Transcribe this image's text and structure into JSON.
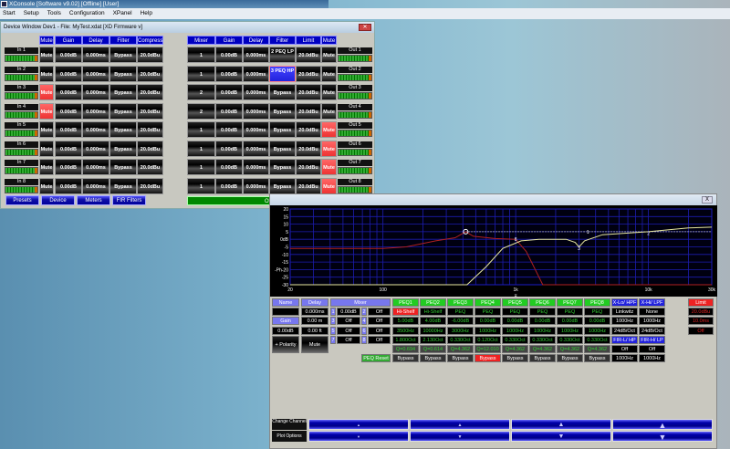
{
  "app": {
    "title": "XConsole [Software v9.02] [Offline] [User]",
    "menu": [
      "Start",
      "Setup",
      "Tools",
      "Configuration",
      "XPanel",
      "Help"
    ]
  },
  "device_window": {
    "title": "Device Window Dev1 -  File: MyTest.xdat [XD Firmware v]",
    "input_headers": [
      "Mute",
      "Gain",
      "Delay",
      "Filter",
      "Compress"
    ],
    "output_headers": [
      "Mixer",
      "Gain",
      "Delay",
      "Filter",
      "Limit",
      "Mute"
    ],
    "inputs": [
      {
        "name": "In 1",
        "mute": "Mute",
        "muted": false,
        "gain": "0.00dB",
        "delay": "0.000ms",
        "filter": "Bypass",
        "compress": "20.0dBu"
      },
      {
        "name": "In 2",
        "mute": "Mute",
        "muted": false,
        "gain": "0.00dB",
        "delay": "0.000ms",
        "filter": "Bypass",
        "compress": "20.0dBu"
      },
      {
        "name": "In 3",
        "mute": "Mute",
        "muted": true,
        "gain": "0.00dB",
        "delay": "0.000ms",
        "filter": "Bypass",
        "compress": "20.0dBu"
      },
      {
        "name": "In 4",
        "mute": "Mute",
        "muted": true,
        "gain": "0.00dB",
        "delay": "0.000ms",
        "filter": "Bypass",
        "compress": "20.0dBu"
      },
      {
        "name": "In 5",
        "mute": "Mute",
        "muted": false,
        "gain": "0.00dB",
        "delay": "0.000ms",
        "filter": "Bypass",
        "compress": "20.0dBu"
      },
      {
        "name": "In 6",
        "mute": "Mute",
        "muted": false,
        "gain": "0.00dB",
        "delay": "0.000ms",
        "filter": "Bypass",
        "compress": "20.0dBu"
      },
      {
        "name": "In 7",
        "mute": "Mute",
        "muted": false,
        "gain": "0.00dB",
        "delay": "0.000ms",
        "filter": "Bypass",
        "compress": "20.0dBu"
      },
      {
        "name": "In 8",
        "mute": "Mute",
        "muted": false,
        "gain": "0.00dB",
        "delay": "0.000ms",
        "filter": "Bypass",
        "compress": "20.0dBu"
      }
    ],
    "outputs": [
      {
        "name": "Out 1",
        "mixer": "1",
        "gain": "0.00dB",
        "delay": "0.000ms",
        "filter": "2 PEQ LP",
        "filter_active": false,
        "limit": "20.0dBu",
        "mute": "Mute",
        "muted": false
      },
      {
        "name": "Out 2",
        "mixer": "1",
        "gain": "0.00dB",
        "delay": "0.000ms",
        "filter": "3 PEQ HP",
        "filter_active": true,
        "limit": "20.0dBu",
        "mute": "Mute",
        "muted": false
      },
      {
        "name": "Out 3",
        "mixer": "2",
        "gain": "0.00dB",
        "delay": "0.000ms",
        "filter": "Bypass",
        "filter_active": false,
        "limit": "20.0dBu",
        "mute": "Mute",
        "muted": false
      },
      {
        "name": "Out 4",
        "mixer": "2",
        "gain": "0.00dB",
        "delay": "0.000ms",
        "filter": "Bypass",
        "filter_active": false,
        "limit": "20.0dBu",
        "mute": "Mute",
        "muted": false
      },
      {
        "name": "Out 5",
        "mixer": "1",
        "gain": "0.00dB",
        "delay": "0.000ms",
        "filter": "Bypass",
        "filter_active": false,
        "limit": "20.0dBu",
        "mute": "Mute",
        "muted": true
      },
      {
        "name": "Out 6",
        "mixer": "1",
        "gain": "0.00dB",
        "delay": "0.000ms",
        "filter": "Bypass",
        "filter_active": false,
        "limit": "20.0dBu",
        "mute": "Mute",
        "muted": true
      },
      {
        "name": "Out 7",
        "mixer": "1",
        "gain": "0.00dB",
        "delay": "0.000ms",
        "filter": "Bypass",
        "filter_active": false,
        "limit": "20.0dBu",
        "mute": "Mute",
        "muted": true
      },
      {
        "name": "Out 8",
        "mixer": "1",
        "gain": "0.00dB",
        "delay": "0.000ms",
        "filter": "Bypass",
        "filter_active": false,
        "limit": "20.0dBu",
        "mute": "Mute",
        "muted": true
      }
    ],
    "buttons": [
      "Presets",
      "Device",
      "Meters",
      "FIR Filters"
    ],
    "status": "Offline Mode"
  },
  "eq_window": {
    "close": "X",
    "plot": {
      "y_ticks": [
        "20",
        "15",
        "10",
        "5",
        "0dB",
        "-5",
        "-10",
        "-15",
        "-Ph-20",
        "-25",
        "-30"
      ],
      "y_values": [
        20,
        15,
        10,
        5,
        0,
        -5,
        -10,
        -15,
        -20,
        -25,
        -30
      ],
      "x_ticks": [
        {
          "label": "20",
          "f": 20
        },
        {
          "label": "100",
          "f": 100
        },
        {
          "label": "1k",
          "f": 1000
        },
        {
          "label": "10k",
          "f": 10000
        },
        {
          "label": "30k",
          "f": 30000
        }
      ],
      "ylim": [
        -30,
        20
      ],
      "xlim": [
        20,
        30000
      ],
      "red_curve": [
        [
          20,
          -6
        ],
        [
          100,
          -6
        ],
        [
          150,
          -5
        ],
        [
          250,
          -1
        ],
        [
          350,
          1
        ],
        [
          420,
          5
        ],
        [
          480,
          2
        ],
        [
          700,
          0.5
        ],
        [
          1000,
          0
        ],
        [
          1200,
          -8
        ],
        [
          1600,
          -30
        ],
        [
          30000,
          -30
        ]
      ],
      "yellow_curve": [
        [
          20,
          -30
        ],
        [
          430,
          -30
        ],
        [
          600,
          -18
        ],
        [
          800,
          -6
        ],
        [
          1100,
          -1
        ],
        [
          1500,
          0
        ],
        [
          2400,
          0
        ],
        [
          2800,
          -2
        ],
        [
          3000,
          -5
        ],
        [
          3300,
          -1
        ],
        [
          4500,
          3
        ],
        [
          10000,
          5
        ],
        [
          20000,
          7.5
        ],
        [
          30000,
          8
        ]
      ],
      "dotted_line": [
        [
          420,
          5
        ],
        [
          30000,
          5
        ]
      ],
      "markers": [
        {
          "label": "1",
          "f": 3500,
          "db": 5
        },
        {
          "label": "2",
          "f": 10000,
          "db": 4
        },
        {
          "label": "3",
          "f": 3000,
          "db": -6
        },
        {
          "label": "8",
          "f": 1000,
          "db": 0
        }
      ],
      "circle": {
        "f": 420,
        "db": 5
      },
      "cursor_icon": "⌅"
    },
    "left": {
      "name_hdr": "Name",
      "name_value": "",
      "delay_hdr": "Delay",
      "delay_ms": "0.000ms",
      "gain_btn": "Gain",
      "delay_m": "0.00 m",
      "gain_value": "0.00dB",
      "delay_ft": "0.00 ft",
      "polarity": "+ Polarity",
      "mute": "Mute"
    },
    "mixer": {
      "hdr": "Mixer",
      "rows": [
        [
          "1",
          "0.00dB",
          "2",
          "Off"
        ],
        [
          "3",
          "Off",
          "4",
          "Off"
        ],
        [
          "5",
          "Off",
          "6",
          "Off"
        ],
        [
          "7",
          "Off",
          "8",
          "Off"
        ]
      ]
    },
    "peq": [
      {
        "hdr": "PEQ1",
        "type": "Hi-Shelf",
        "type_active": true,
        "gain": "5.00dB",
        "freq": "3500Hz",
        "bw": "1.800Oct",
        "q": "Q=0.694",
        "bypass": "Bypass",
        "bypassed": false
      },
      {
        "hdr": "PEQ2",
        "type": "Hi-Shelf",
        "type_active": false,
        "gain": "4.00dB",
        "freq": "10000Hz",
        "bw": "2.130Oct",
        "q": "Q=0.614",
        "bypass": "Bypass",
        "bypassed": false
      },
      {
        "hdr": "PEQ3",
        "type": "PEQ",
        "type_active": false,
        "gain": "-6.00dB",
        "freq": "3000Hz",
        "bw": "0.330Oct",
        "q": "Q=4.362",
        "bypass": "Bypass",
        "bypassed": false
      },
      {
        "hdr": "PEQ4",
        "type": "PEQ",
        "type_active": false,
        "gain": "0.00dB",
        "freq": "1000Hz",
        "bw": "0.120Oct",
        "q": "Q=12.010",
        "bypass": "Bypass",
        "bypassed": true
      },
      {
        "hdr": "PEQ5",
        "type": "PEQ",
        "type_active": false,
        "gain": "0.00dB",
        "freq": "1000Hz",
        "bw": "0.330Oct",
        "q": "Q=4.362",
        "bypass": "Bypass",
        "bypassed": false
      },
      {
        "hdr": "PEQ6",
        "type": "PEQ",
        "type_active": false,
        "gain": "0.00dB",
        "freq": "1000Hz",
        "bw": "0.330Oct",
        "q": "Q=4.362",
        "bypass": "Bypass",
        "bypassed": false
      },
      {
        "hdr": "PEQ7",
        "type": "PEQ",
        "type_active": false,
        "gain": "0.00dB",
        "freq": "1000Hz",
        "bw": "0.330Oct",
        "q": "Q=4.362",
        "bypass": "Bypass",
        "bypassed": false
      },
      {
        "hdr": "PEQ8",
        "type": "PEQ",
        "type_active": false,
        "gain": "0.00dB",
        "freq": "1000Hz",
        "bw": "0.330Oct",
        "q": "Q=4.362",
        "bypass": "Bypass",
        "bypassed": false
      }
    ],
    "peq_reset": "PEQ Reset",
    "xover": [
      {
        "hdr": "X-Lo/ HPF",
        "type": "Linkwitz",
        "freq": "1000Hz",
        "slope": "24dB/Oct",
        "fir_hdr": "FIR-L/ HP",
        "fir": "Off",
        "fir_freq": "1000Hz"
      },
      {
        "hdr": "X-Hi/ LPF",
        "type": "None",
        "freq": "1000Hz",
        "slope": "24dB/Oct",
        "fir_hdr": "FIR-H/ LP",
        "fir": "Off",
        "fir_freq": "1000Hz"
      }
    ],
    "limit": {
      "hdr": "Limit",
      "threshold": "20.0dBu",
      "time": "10.0ms",
      "state": "Off"
    },
    "nav": {
      "change_channel": "Change Channel",
      "plot_options": "Plot Options",
      "up": "▲",
      "down": "▼"
    }
  }
}
